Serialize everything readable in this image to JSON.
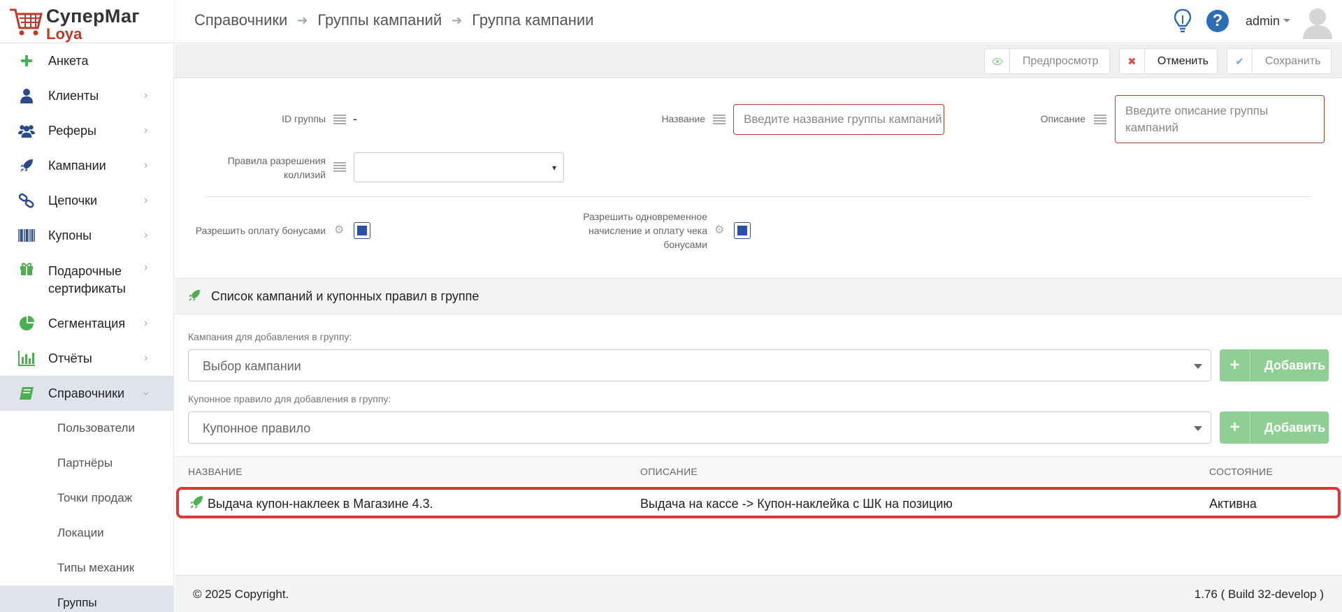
{
  "app": {
    "brand_title": "СуперМаг",
    "brand_sub": "Loya"
  },
  "breadcrumb": [
    "Справочники",
    "Группы кампаний",
    "Группа кампании"
  ],
  "header": {
    "user": "admin"
  },
  "sidebar": {
    "items": [
      {
        "label": "Анкета",
        "icon": "plus-icon"
      },
      {
        "label": "Клиенты",
        "icon": "user-icon"
      },
      {
        "label": "Реферы",
        "icon": "users-icon"
      },
      {
        "label": "Кампании",
        "icon": "rocket-icon"
      },
      {
        "label": "Цепочки",
        "icon": "chain-icon"
      },
      {
        "label": "Купоны",
        "icon": "barcode-icon"
      },
      {
        "label": "Подарочные сертификаты",
        "icon": "gift-icon"
      },
      {
        "label": "Сегментация",
        "icon": "pie-chart-icon"
      },
      {
        "label": "Отчёты",
        "icon": "bar-chart-icon"
      },
      {
        "label": "Справочники",
        "icon": "book-icon"
      }
    ],
    "sub_items": [
      "Пользователи",
      "Партнёры",
      "Точки продаж",
      "Локации",
      "Типы механик",
      "Группы"
    ]
  },
  "toolbar": {
    "preview": "Предпросмотр",
    "cancel": "Отменить",
    "save": "Сохранить"
  },
  "form": {
    "id_label": "ID группы",
    "id_value": "-",
    "name_label": "Название",
    "name_placeholder": "Введите название группы кампаний",
    "desc_label": "Описание",
    "desc_placeholder": "Введите описание группы кампаний",
    "collision_label_1": "Правила разрешения",
    "collision_label_2": "коллизий",
    "bonus_pay_label": "Разрешить оплату бонусами",
    "simul_label_1": "Разрешить одновременное",
    "simul_label_2": "начисление и оплату чека",
    "simul_label_3": "бонусами",
    "bonus_pay_checked": true,
    "simul_checked": true
  },
  "campaigns": {
    "title": "Список кампаний и купонных правил в группе",
    "campaign_label": "Кампания для добавления в группу:",
    "campaign_placeholder": "Выбор кампании",
    "coupon_label": "Купонное правило для добавления в группу:",
    "coupon_placeholder": "Купонное правило",
    "add_label": "Добавить",
    "columns": [
      "НАЗВАНИЕ",
      "ОПИСАНИЕ",
      "СОСТОЯНИЕ"
    ],
    "rows": [
      {
        "name": "Выдача купон-наклеек в Магазине 4.3.",
        "description": "Выдача на кассе -> Купон-наклейка с ШК на позицию",
        "status": "Активна"
      }
    ]
  },
  "footer": {
    "copyright": "© 2025 Copyright.",
    "version": "1.76 ( Build 32-develop )"
  },
  "colors": {
    "accent_red": "#c0392b",
    "accent_green": "#8fcf93",
    "checkbox_blue": "#2a4fa8",
    "sidebar_active": "#dfe3ec"
  }
}
